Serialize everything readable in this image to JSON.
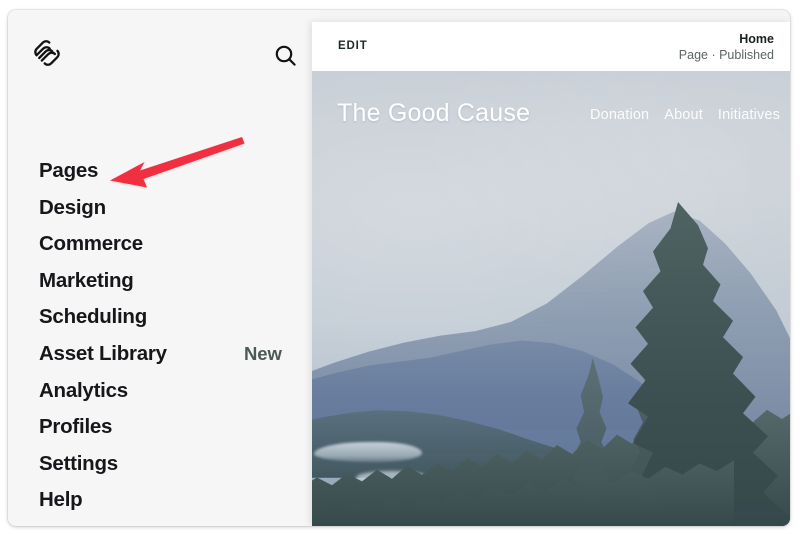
{
  "app": {
    "name": "Squarespace",
    "logo_icon": "squarespace-logo-icon"
  },
  "sidebar": {
    "search_icon": "search-icon",
    "items": [
      {
        "label": "Pages",
        "badge": ""
      },
      {
        "label": "Design",
        "badge": ""
      },
      {
        "label": "Commerce",
        "badge": ""
      },
      {
        "label": "Marketing",
        "badge": ""
      },
      {
        "label": "Scheduling",
        "badge": ""
      },
      {
        "label": "Asset Library",
        "badge": "New"
      },
      {
        "label": "Analytics",
        "badge": ""
      },
      {
        "label": "Profiles",
        "badge": ""
      },
      {
        "label": "Settings",
        "badge": ""
      },
      {
        "label": "Help",
        "badge": ""
      }
    ]
  },
  "preview": {
    "header": {
      "edit_label": "EDIT",
      "page_title": "Home",
      "page_status": "Page · Published"
    },
    "site": {
      "title": "The Good Cause",
      "nav_links": [
        "Donation",
        "About",
        "Initiatives"
      ]
    }
  },
  "annotation": {
    "arrow_icon": "red-arrow-pointing-left-icon",
    "arrow_color": "#F03040",
    "points_at": "Pages"
  },
  "colors": {
    "sidebar_bg": "#F6F6F6",
    "panel_bg": "#FFFFFF",
    "nav_text": "#16171A",
    "badge_text": "#4C5A57",
    "meta_text": "#5C6663",
    "accent_red": "#F03040",
    "hero_sky": "#C6CED6",
    "hero_forest": "#3E5254"
  }
}
